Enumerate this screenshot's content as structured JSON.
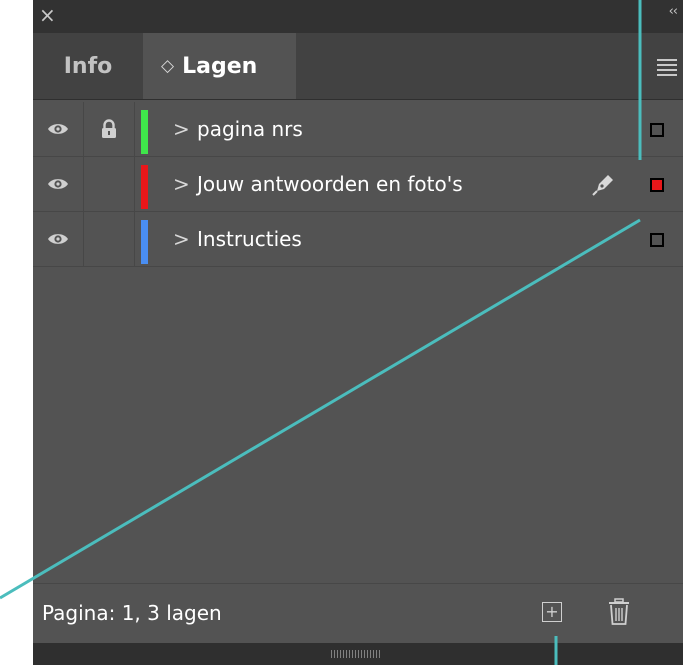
{
  "window": {
    "close_glyph": "×",
    "collapse_glyph": "‹‹"
  },
  "tabs": [
    {
      "label": "Info",
      "active": false
    },
    {
      "label": "Lagen",
      "active": true,
      "prefix_glyph": "◇"
    }
  ],
  "layers": [
    {
      "name": "pagina nrs",
      "visible": true,
      "locked": true,
      "color": "#3fe64b",
      "current": false,
      "selected_indicator": "empty"
    },
    {
      "name": "Jouw antwoorden en foto's",
      "visible": true,
      "locked": false,
      "color": "#e8171a",
      "current": true,
      "selected_indicator": "red"
    },
    {
      "name": "Instructies",
      "visible": true,
      "locked": false,
      "color": "#4a8ef2",
      "current": false,
      "selected_indicator": "empty"
    }
  ],
  "footer": {
    "status": "Pagina: 1, 3 lagen",
    "new_layer_icon": "plus-square-icon",
    "delete_icon": "trash-icon"
  },
  "colors": {
    "panel_bg": "#535353",
    "tab_bar_bg": "#424242",
    "title_bar_bg": "#323232",
    "callout_line": "#4bbdbd"
  }
}
